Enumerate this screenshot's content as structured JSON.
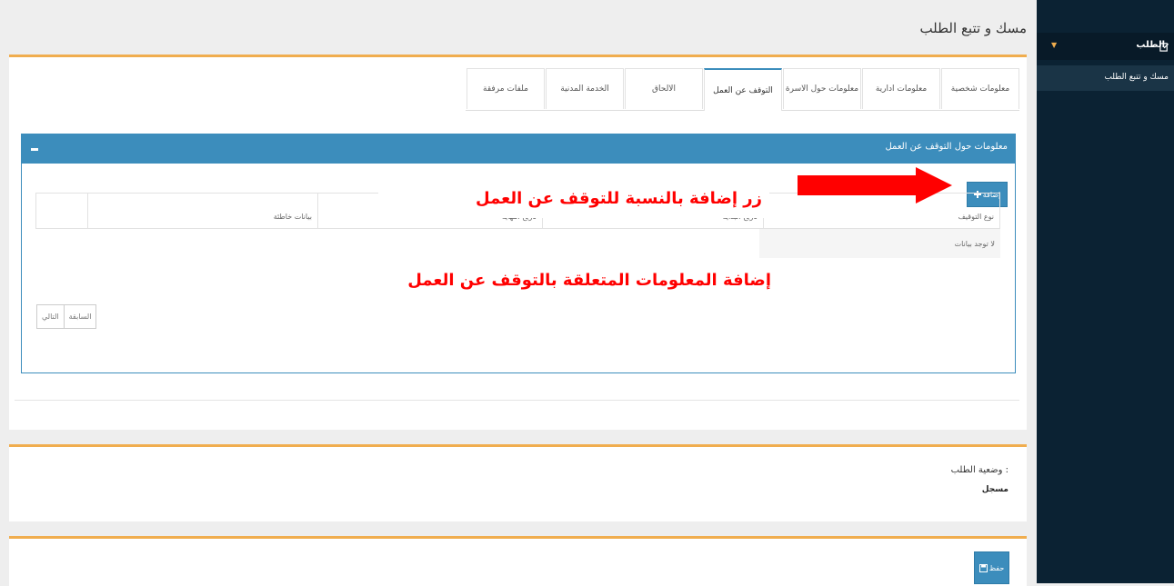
{
  "sidebar": {
    "group_label": "الطلب",
    "sub_item": "مسك و تتبع الطلب"
  },
  "page": {
    "title": "مسك و تتبع الطلب"
  },
  "tabs": [
    {
      "label": "معلومات شخصية",
      "active": false
    },
    {
      "label": "معلومات ادارية",
      "active": false
    },
    {
      "label": "معلومات حول الاسرة",
      "active": false
    },
    {
      "label": "التوقف عن العمل",
      "active": true
    },
    {
      "label": "الالحاق",
      "active": false
    },
    {
      "label": "الخدمة المدنية",
      "active": false
    },
    {
      "label": "ملفات مرفقة",
      "active": false
    }
  ],
  "section": {
    "title": "معلومات حول التوقف عن العمل",
    "add_label": "إضافة",
    "columns": [
      "نوع التوقيف",
      "تاريخ البداية",
      "تاريخ النهاية",
      "بيانات خاطئة",
      ""
    ],
    "empty_text": "لا توجد بيانات",
    "pager": {
      "prev": "السابقة",
      "next": "التالي"
    }
  },
  "annotations": {
    "add_button_note": "زر إضافة بالنسبة للتوقف عن العمل",
    "info_note": "إضافة المعلومات   المتعلقة بالتوقف عن العمل"
  },
  "status": {
    "label": "وضعية الطلب :",
    "value": "مسجل"
  },
  "save": {
    "label": "حفظ"
  },
  "colors": {
    "accent": "#3c8dbc",
    "orange": "#f0ad4e",
    "sidebar": "#0b2233",
    "annotation": "#ff0000"
  }
}
